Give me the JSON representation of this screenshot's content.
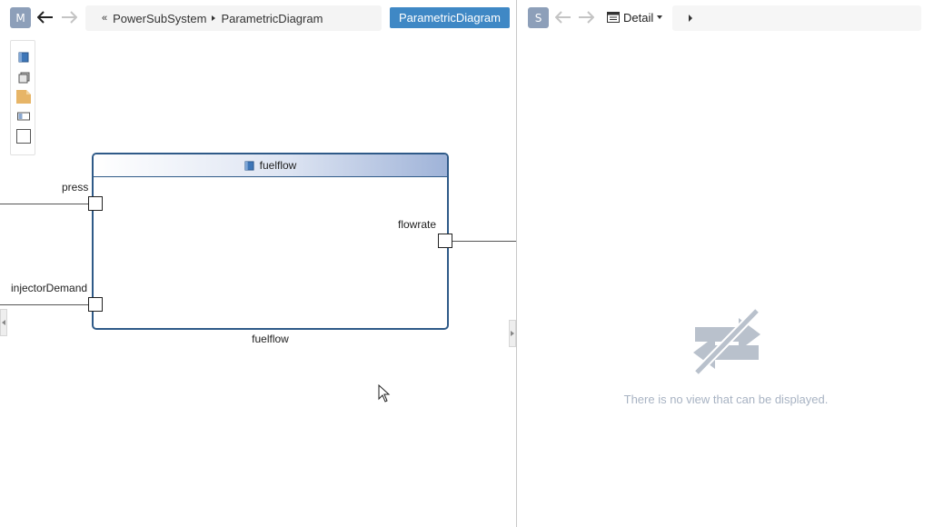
{
  "left_toolbar": {
    "model_badge": "M",
    "breadcrumb": [
      "PowerSubSystem",
      "ParametricDiagram"
    ],
    "diagram_tab": "ParametricDiagram"
  },
  "palette": {
    "items": [
      "block-icon",
      "stack-icon",
      "note-icon",
      "property-icon",
      "rectangle-icon"
    ]
  },
  "diagram": {
    "block": {
      "header": "fuelflow",
      "footer": "fuelflow"
    },
    "ports": {
      "press": "press",
      "injectorDemand": "injectorDemand",
      "flowrate": "flowrate"
    }
  },
  "right_toolbar": {
    "spec_badge": "S",
    "view_selector": "Detail"
  },
  "right_pane": {
    "empty_message": "There is no view that can be displayed."
  },
  "colors": {
    "accent": "#3f88c5",
    "badge": "#8d9fb9",
    "block_border": "#2f5a88",
    "empty_text": "#a8b3c3"
  }
}
